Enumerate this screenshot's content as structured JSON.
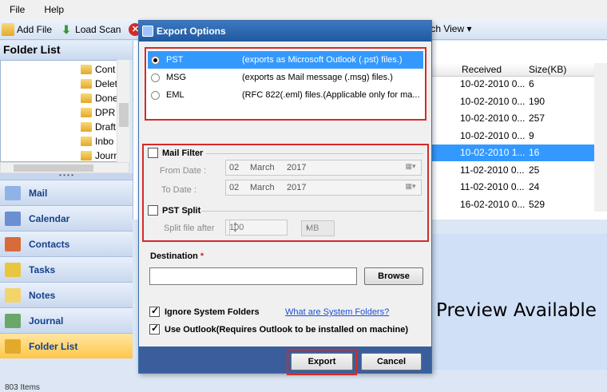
{
  "menu": [
    "File",
    "Help"
  ],
  "toolbar": {
    "add_file": "Add File",
    "load_scan": "Load Scan",
    "switch_view": "tch View ▾"
  },
  "folder_list": {
    "title": "Folder List",
    "items": [
      "Cont",
      "Delet",
      "Done",
      "DPR",
      "Draft",
      "Inbo",
      "Journ"
    ]
  },
  "nav": [
    "Mail",
    "Calendar",
    "Contacts",
    "Tasks",
    "Notes",
    "Journal",
    "Folder List"
  ],
  "status_text": "803 Items",
  "list": {
    "columns": [
      "Received",
      "Size(KB)"
    ],
    "rows": [
      {
        "left": "10-02-2010 0...",
        "received": "10-02-2010 0...",
        "size": "6"
      },
      {
        "left": "10-02-2010 0...",
        "received": "10-02-2010 0...",
        "size": "190"
      },
      {
        "left": "10-02-2010 0...",
        "received": "10-02-2010 0...",
        "size": "257"
      },
      {
        "left": "10-02-2010 0...",
        "received": "10-02-2010 0...",
        "size": "9"
      },
      {
        "left": "10-02-2010 1...",
        "received": "10-02-2010 1...",
        "size": "16"
      },
      {
        "left": "11-02-2010 0...",
        "received": "11-02-2010 0...",
        "size": "25"
      },
      {
        "left": "11-02-2010 0...",
        "received": "11-02-2010 0...",
        "size": "24"
      },
      {
        "left": "16-02-2010 0...",
        "received": "16-02-2010 0...",
        "size": "529"
      }
    ],
    "selected_index": 4
  },
  "preview_text": "Preview Available",
  "dialog": {
    "title": "Export Options",
    "formats": [
      {
        "name": "PST",
        "desc": "(exports as Microsoft Outlook (.pst) files.)",
        "selected": true
      },
      {
        "name": "MSG",
        "desc": "(exports as Mail message (.msg) files.)",
        "selected": false
      },
      {
        "name": "EML",
        "desc": "(RFC 822(.eml) files.(Applicable only for ma...",
        "selected": false
      }
    ],
    "mail_filter": {
      "label": "Mail Filter",
      "from_label": "From Date :",
      "to_label": "To Date :",
      "from": {
        "day": "02",
        "month": "March",
        "year": "2017"
      },
      "to": {
        "day": "02",
        "month": "March",
        "year": "2017"
      }
    },
    "pst_split": {
      "label": "PST Split",
      "split_label": "Split file after",
      "value": "100",
      "unit": "MB"
    },
    "destination": {
      "label": "Destination",
      "required_mark": "*",
      "value": "",
      "browse": "Browse"
    },
    "ignore_system": {
      "label": "Ignore System Folders",
      "checked": true
    },
    "system_link": "What are System Folders?",
    "use_outlook": {
      "label": "Use Outlook(Requires Outlook to be installed on machine)",
      "checked": true
    },
    "export_btn": "Export",
    "cancel_btn": "Cancel"
  }
}
